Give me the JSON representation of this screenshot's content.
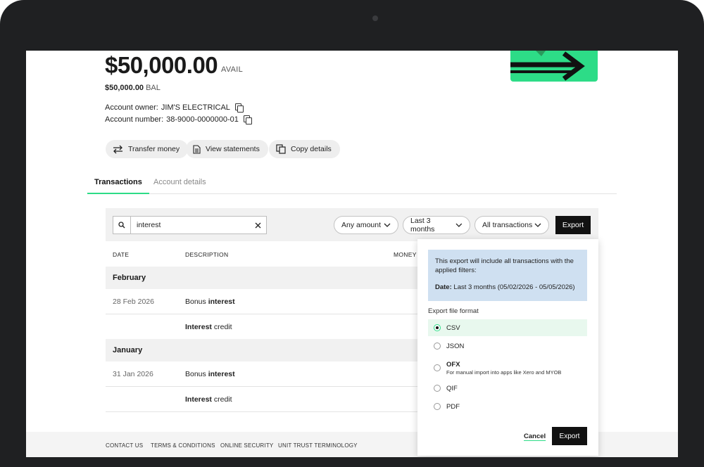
{
  "account": {
    "balance_available": "$50,000.00",
    "avail_label": "AVAIL",
    "balance": "$50,000.00",
    "bal_label": "BAL",
    "owner_label": "Account owner:",
    "owner_value": "JIM'S ELECTRICAL",
    "number_label": "Account number:",
    "number_value": "38-9000-0000000-01"
  },
  "actions": {
    "transfer": "Transfer money",
    "statements": "View statements",
    "copy": "Copy details"
  },
  "tabs": [
    {
      "label": "Transactions",
      "active": true
    },
    {
      "label": "Account details",
      "active": false
    }
  ],
  "filters": {
    "search_value": "interest",
    "amount": "Any amount",
    "period": "Last 3 months",
    "type": "All transactions",
    "export": "Export"
  },
  "table": {
    "headers": [
      "DATE",
      "DESCRIPTION",
      "MONEY"
    ],
    "groups": [
      {
        "month": "February",
        "rows": [
          {
            "date": "28 Feb 2026",
            "desc_prefix": "Bonus ",
            "desc_bold": "interest",
            "desc_suffix": ""
          },
          {
            "date": "",
            "desc_prefix": "",
            "desc_bold": "Interest",
            "desc_suffix": " credit"
          }
        ]
      },
      {
        "month": "January",
        "rows": [
          {
            "date": "31 Jan 2026",
            "desc_prefix": "Bonus ",
            "desc_bold": "interest",
            "desc_suffix": ""
          },
          {
            "date": "",
            "desc_prefix": "",
            "desc_bold": "Interest",
            "desc_suffix": " credit"
          }
        ]
      }
    ]
  },
  "export_popover": {
    "info_text": "This export will include all transactions with the applied filters:",
    "date_label": "Date:",
    "date_value": "Last 3 months (05/02/2026 - 05/05/2026)",
    "format_label": "Export file format",
    "options": [
      {
        "label": "CSV",
        "selected": true,
        "note": ""
      },
      {
        "label": "JSON",
        "selected": false,
        "note": ""
      },
      {
        "label": "OFX",
        "selected": false,
        "note": "For manual import into apps like Xero and MYOB"
      },
      {
        "label": "QIF",
        "selected": false,
        "note": ""
      },
      {
        "label": "PDF",
        "selected": false,
        "note": ""
      }
    ],
    "cancel": "Cancel",
    "export": "Export"
  },
  "footer": {
    "links": [
      "CONTACT US",
      "TERMS & CONDITIONS",
      "ONLINE SECURITY",
      "UNIT TRUST TERMINOLOGY"
    ]
  },
  "colors": {
    "accent": "#2ddc87",
    "info_bg": "#cfe0f1",
    "button_dark": "#111111"
  }
}
